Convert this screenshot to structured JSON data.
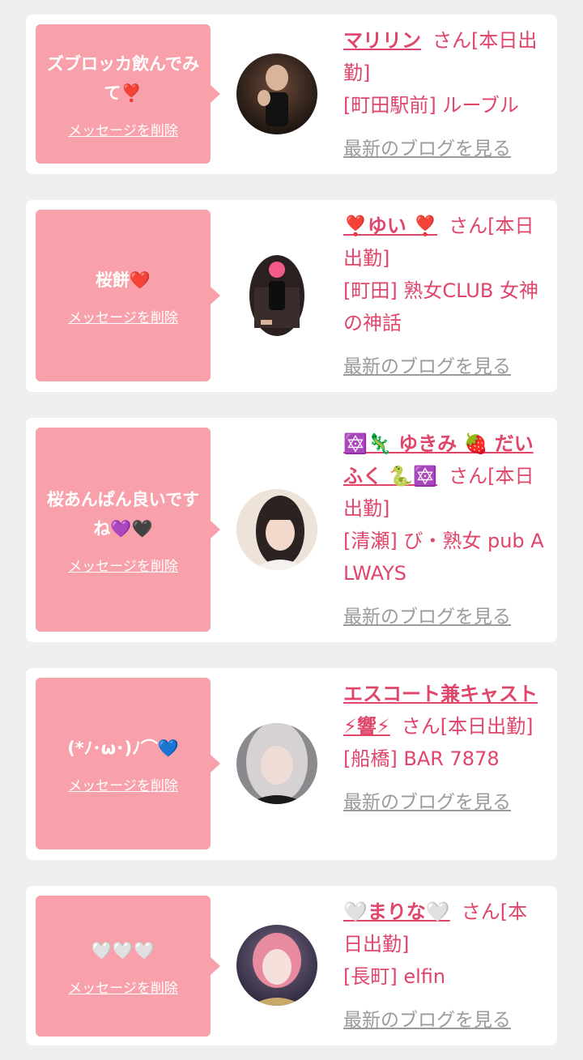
{
  "delete_label": "メッセージを削除",
  "blog_label": "最新のブログを見る",
  "colors": {
    "background": "#efefef",
    "bubble": "#f9a1ab",
    "accent": "#e0456a",
    "link_gray": "#9b9b9b"
  },
  "items": [
    {
      "message": "ズブロッカ飲んでみて❣️",
      "name": "マリリン",
      "suffix": "さん[本日出勤]",
      "shop": "[町田駅前] ルーブル"
    },
    {
      "message": "桜餅❤️",
      "name": "❣️ゆい ❣️",
      "suffix": "さん[本日出勤]",
      "shop": "[町田] 熟女CLUB 女神の神話"
    },
    {
      "message": "桜あんぱん良いですね💜🖤",
      "name": "🔯🦎 ゆきみ 🍓 だいふく 🐍🔯",
      "suffix": "さん[本日出勤]",
      "shop": "[清瀬] び・熟女 pub ALWAYS"
    },
    {
      "message": "(*ﾉ･ω･)ﾉ⌒💙",
      "name": "エスコート兼キャスト⚡響⚡",
      "suffix": "さん[本日出勤]",
      "shop": "[船橋] BAR 7878"
    },
    {
      "message": "🤍🤍🤍",
      "name": "🤍まりな🤍",
      "suffix": "さん[本日出勤]",
      "shop": "[長町] elfin"
    }
  ]
}
